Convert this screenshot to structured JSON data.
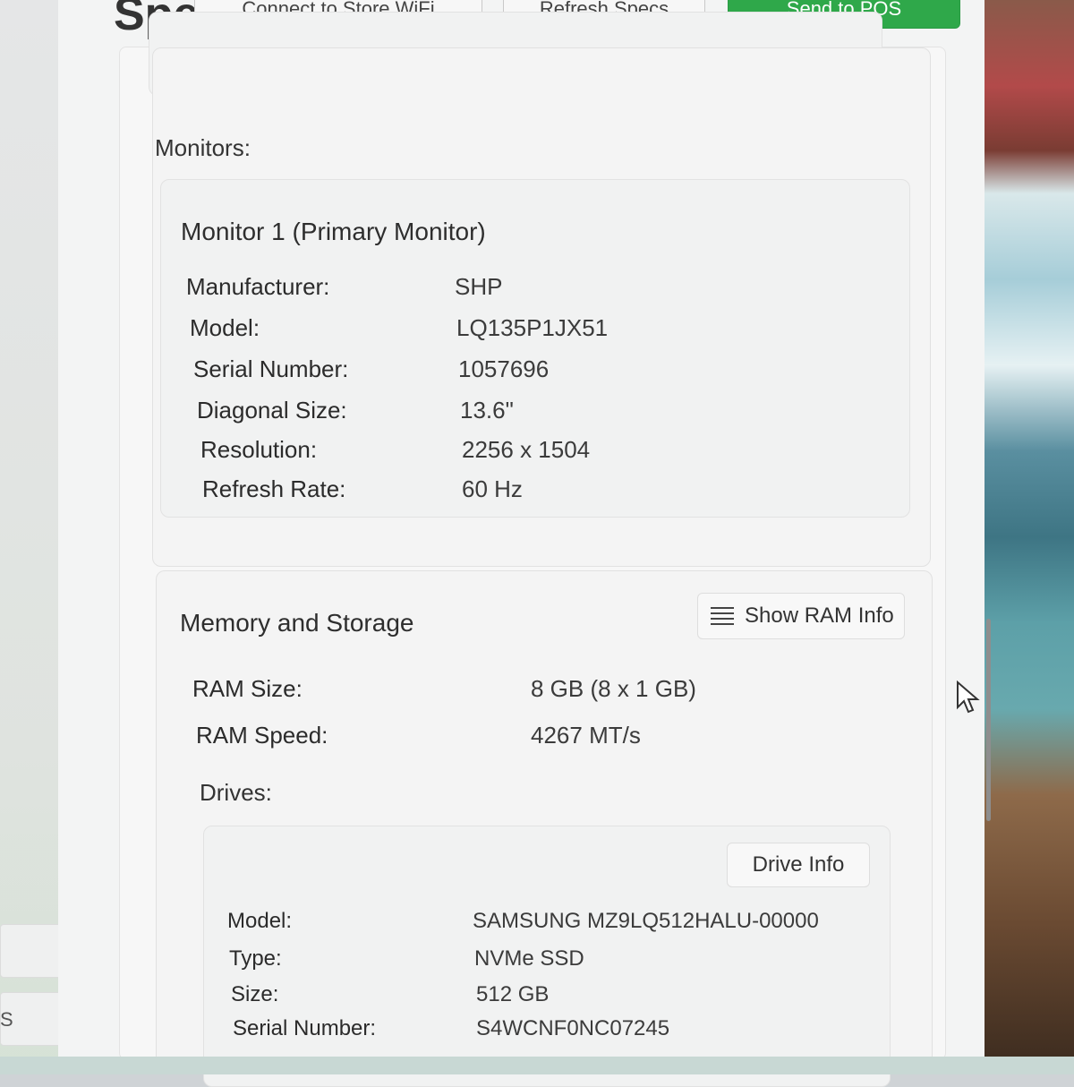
{
  "header": {
    "title_partial": "Spe",
    "buttons": {
      "connect_wifi": "Connect to Store WiFi",
      "refresh_specs": "Refresh Specs",
      "send": "Send to POS"
    }
  },
  "monitors": {
    "section_label": "Monitors:",
    "items": [
      {
        "title": "Monitor 1 (Primary Monitor)",
        "rows": [
          {
            "label": "Manufacturer:",
            "value": "SHP"
          },
          {
            "label": "Model:",
            "value": "LQ135P1JX51"
          },
          {
            "label": "Serial Number:",
            "value": "1057696"
          },
          {
            "label": "Diagonal Size:",
            "value": "13.6\""
          },
          {
            "label": "Resolution:",
            "value": "2256 x 1504"
          },
          {
            "label": "Refresh Rate:",
            "value": "60 Hz"
          }
        ]
      }
    ]
  },
  "memory_storage": {
    "title": "Memory and Storage",
    "show_ram_button": "Show RAM Info",
    "rows": [
      {
        "label": "RAM Size:",
        "value": "8 GB (8 x 1 GB)"
      },
      {
        "label": "RAM Speed:",
        "value": "4267 MT/s"
      }
    ],
    "drives_label": "Drives:",
    "drives": [
      {
        "info_button": "Drive Info",
        "rows": [
          {
            "label": "Model:",
            "value": "SAMSUNG MZ9LQ512HALU-00000"
          },
          {
            "label": "Type:",
            "value": "NVMe SSD"
          },
          {
            "label": "Size:",
            "value": "512 GB"
          },
          {
            "label": "Serial Number:",
            "value": "S4WCNF0NC07245"
          }
        ]
      }
    ]
  },
  "sidebar": {
    "glyph": "S"
  }
}
